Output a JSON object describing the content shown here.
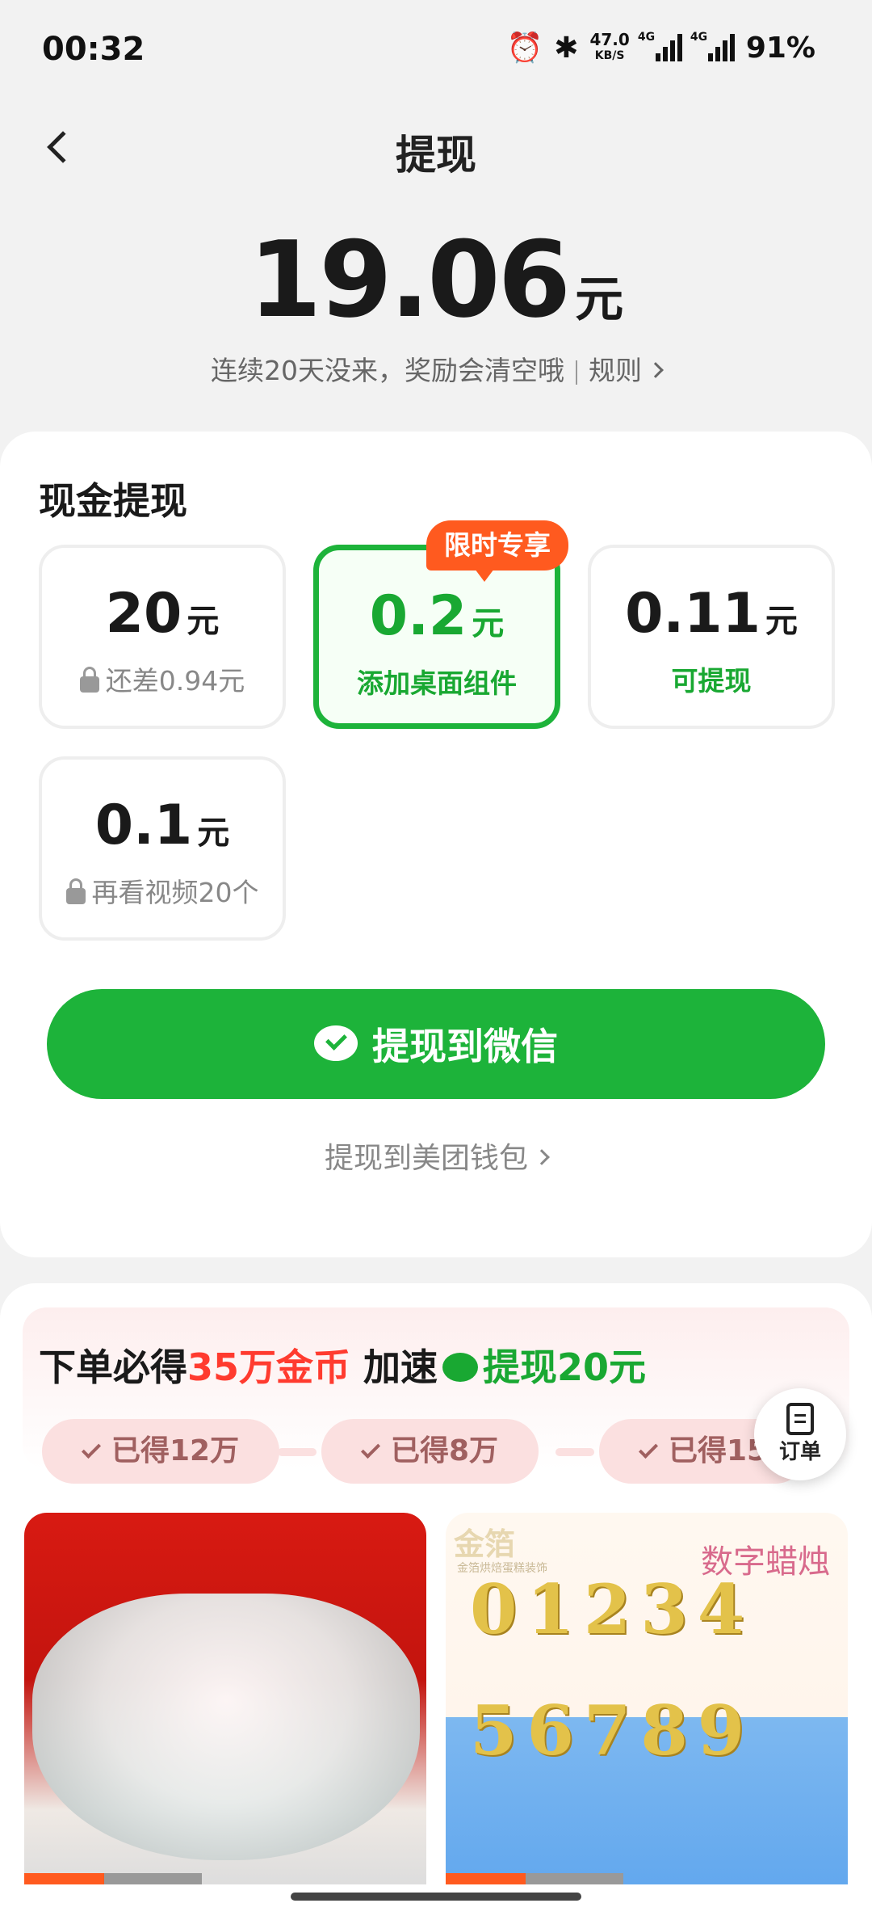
{
  "status_bar": {
    "time": "00:32",
    "net_speed": "47.0",
    "net_unit": "KB/S",
    "sig1": "4G",
    "sig2": "4G",
    "battery": "91%"
  },
  "header": {
    "title": "提现"
  },
  "balance": {
    "amount": "19.06",
    "unit": "元",
    "note": "连续20天没来，奖励会清空哦",
    "rule_label": "规则"
  },
  "cash": {
    "section_title": "现金提现",
    "badge": "限时专享",
    "options": [
      {
        "amount": "20",
        "unit": "元",
        "sub": "还差0.94元",
        "locked": true,
        "selected": false
      },
      {
        "amount": "0.2",
        "unit": "元",
        "sub": "添加桌面组件",
        "locked": false,
        "selected": true
      },
      {
        "amount": "0.11",
        "unit": "元",
        "sub": "可提现",
        "locked": false,
        "selected": false
      },
      {
        "amount": "0.1",
        "unit": "元",
        "sub": "再看视频20个",
        "locked": true,
        "selected": false
      }
    ],
    "wechat_button": "提现到微信",
    "meituan_link": "提现到美团钱包"
  },
  "promo": {
    "title_pre": "下单必得",
    "title_highlight": "35万金币",
    "title_mid": "加速",
    "title_green": "提现20元",
    "steps": [
      "已得12万",
      "已得8万",
      "已得15"
    ],
    "order_button": "订单"
  },
  "products": [
    {
      "brand": "",
      "caption": ""
    },
    {
      "brand": "金箔",
      "brand_sub": "金箔烘焙蛋糕装饰",
      "caption": "数字蜡烛",
      "digits_row1": "01234",
      "digits_row2": "56789"
    }
  ],
  "colors": {
    "accent_green": "#1db33a",
    "badge_orange": "#ff5a1f",
    "highlight_red": "#ff3b2f"
  }
}
